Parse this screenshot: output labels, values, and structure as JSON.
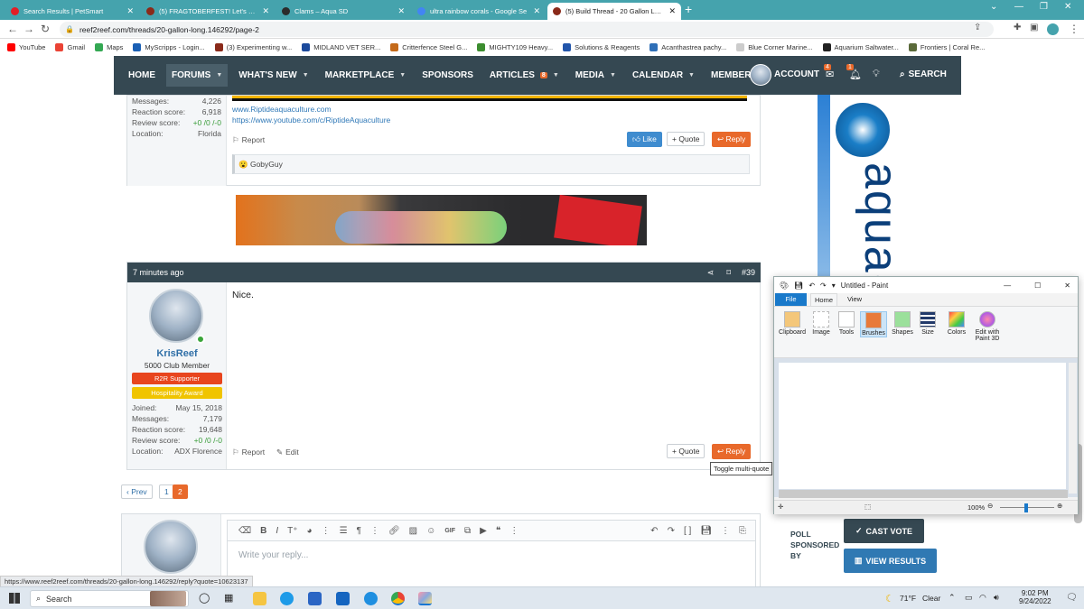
{
  "browser": {
    "tabs": [
      {
        "title": "Search Results | PetSmart",
        "color": "#e31f26"
      },
      {
        "title": "(5) FRAGTOBERFEST! Let's get th",
        "color": "#8a2a1a"
      },
      {
        "title": "Clams – Aqua SD",
        "color": "#2b2b2b"
      },
      {
        "title": "ultra rainbow corals - Google Se",
        "color": "#4285f4"
      },
      {
        "title": "(5) Build Thread - 20 Gallon Long",
        "color": "#8a2a1a"
      }
    ],
    "new_tab": "+",
    "url": "reef2reef.com/threads/20-gallon-long.146292/page-2",
    "bookmarks": [
      {
        "label": "YouTube",
        "color": "#ff0000"
      },
      {
        "label": "Gmail",
        "color": "#ea4335"
      },
      {
        "label": "Maps",
        "color": "#34a853"
      },
      {
        "label": "MyScripps - Login...",
        "color": "#1a5fb4"
      },
      {
        "label": "(3) Experimenting w...",
        "color": "#8a2a1a"
      },
      {
        "label": "MIDLAND VET SER...",
        "color": "#1c4a9c"
      },
      {
        "label": "Critterfence Steel G...",
        "color": "#c46a1a"
      },
      {
        "label": "MIGHTY109 Heavy...",
        "color": "#3c8d2f"
      },
      {
        "label": "Solutions & Reagents",
        "color": "#2255aa"
      },
      {
        "label": "Acanthastrea pachy...",
        "color": "#2f6fb7"
      },
      {
        "label": "Blue Corner Marine...",
        "color": "#cccccc"
      },
      {
        "label": "Aquarium Saltwater...",
        "color": "#222222"
      },
      {
        "label": "Frontiers | Coral Re...",
        "color": "#5a6a3a"
      }
    ]
  },
  "site_nav": {
    "items": [
      "HOME",
      "FORUMS",
      "WHAT'S NEW",
      "MARKETPLACE",
      "SPONSORS",
      "ARTICLES",
      "MEDIA",
      "CALENDAR",
      "MEMBERS"
    ],
    "articles_badge": "8",
    "account": "ACCOUNT",
    "account_badge": "4",
    "alerts_badge": "1",
    "search": "SEARCH"
  },
  "post_prev": {
    "stats": [
      {
        "label": "Messages:",
        "value": "4,226"
      },
      {
        "label": "Reaction score:",
        "value": "6,918"
      },
      {
        "label": "Review score:",
        "value": "+0 /0 /-0"
      },
      {
        "label": "Location:",
        "value": "Florida"
      }
    ],
    "links": [
      "www.Riptideaquaculture.com",
      "https://www.youtube.com/c/RiptideAquaculture"
    ],
    "report": "Report",
    "like": "Like",
    "quote": "Quote",
    "reply": "Reply",
    "reaction_user": "GobyGuy"
  },
  "post_39": {
    "time": "7 minutes ago",
    "number": "#39",
    "username": "KrisReef",
    "title": "5000 Club Member",
    "banners": [
      "R2R Supporter",
      "Hospitality Award"
    ],
    "stats": [
      {
        "label": "Joined:",
        "value": "May 15, 2018"
      },
      {
        "label": "Messages:",
        "value": "7,179"
      },
      {
        "label": "Reaction score:",
        "value": "19,648"
      },
      {
        "label": "Review score:",
        "value": "+0 /0 /-0"
      },
      {
        "label": "Location:",
        "value": "ADX Florence"
      }
    ],
    "body": "Nice.",
    "report": "Report",
    "edit": "Edit",
    "quote": "Quote",
    "reply": "Reply",
    "tooltip": "Toggle multi-quote"
  },
  "pagination": {
    "prev": "Prev",
    "pages": [
      "1",
      "2"
    ],
    "current": "2"
  },
  "editor": {
    "placeholder": "Write your reply..."
  },
  "sidebar": {
    "ad_text": "aquacav",
    "poll_sponsored_by": "POLL\nSPONSORED\nBY",
    "cast_vote": "CAST VOTE",
    "view_results": "VIEW RESULTS"
  },
  "status_url": "https://www.reef2reef.com/threads/20-gallon-long.146292/reply?quote=10623137",
  "paint": {
    "title": "Untitled - Paint",
    "tabs": [
      "File",
      "Home",
      "View"
    ],
    "tools": [
      "Clipboard",
      "Image",
      "Tools",
      "Brushes",
      "Shapes",
      "Size",
      "Colors",
      "Edit with Paint 3D"
    ],
    "zoom": "100%"
  },
  "taskbar": {
    "search": "Search",
    "weather": "71°F",
    "weather_desc": "Clear",
    "time": "9:02 PM",
    "date": "9/24/2022"
  }
}
